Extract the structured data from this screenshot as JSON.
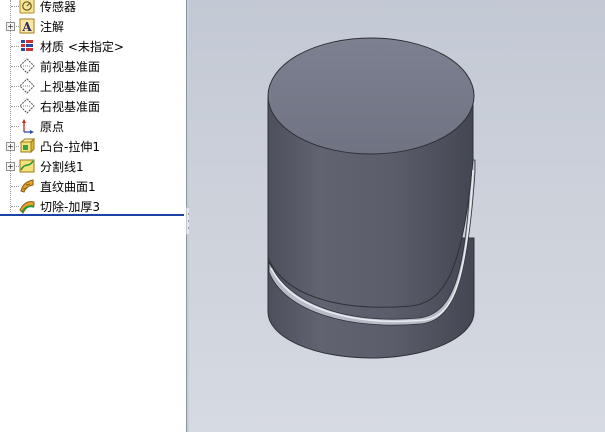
{
  "feature_tree": {
    "items": [
      {
        "label": "传感器",
        "icon": "sensor-icon",
        "expandable": false
      },
      {
        "label": "注解",
        "icon": "annotation-icon",
        "expandable": true
      },
      {
        "label": "材质 <未指定>",
        "icon": "material-icon",
        "expandable": false
      },
      {
        "label": "前视基准面",
        "icon": "plane-icon",
        "expandable": false
      },
      {
        "label": "上视基准面",
        "icon": "plane-icon",
        "expandable": false
      },
      {
        "label": "右视基准面",
        "icon": "plane-icon",
        "expandable": false
      },
      {
        "label": "原点",
        "icon": "origin-icon",
        "expandable": false
      },
      {
        "label": "凸台-拉伸1",
        "icon": "extrude-icon",
        "expandable": true
      },
      {
        "label": "分割线1",
        "icon": "split-line-icon",
        "expandable": true
      },
      {
        "label": "直纹曲面1",
        "icon": "ruled-surface-icon",
        "expandable": false
      },
      {
        "label": "切除-加厚3",
        "icon": "cut-thicken-icon",
        "expandable": false
      }
    ]
  },
  "colors": {
    "rollback_bar": "#1a44a6",
    "model_top": "#727685",
    "model_side": "#5b5e6b",
    "viewport_bg": "#c9ced8"
  }
}
